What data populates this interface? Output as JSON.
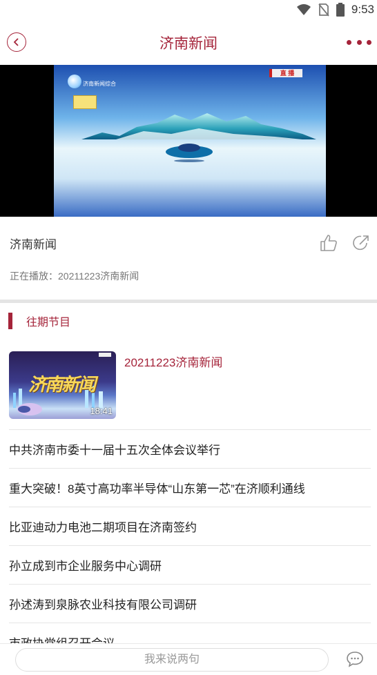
{
  "status_bar": {
    "time": "9:53",
    "icons": [
      "wifi-icon",
      "no-sim-icon",
      "battery-icon"
    ]
  },
  "header": {
    "title": "济南新闻",
    "back_icon": "chevron-left-icon",
    "more_icon": "more-dots-icon"
  },
  "colors": {
    "accent": "#a5243a",
    "divider": "#e4e4e4",
    "muted_text": "#777777"
  },
  "video": {
    "live_tag": "直 播",
    "channel_name": "济南新闻综合"
  },
  "info": {
    "title": "济南新闻",
    "playing_prefix": "正在播放：",
    "playing_title": "20211223济南新闻",
    "like_icon": "thumbs-up-icon",
    "share_icon": "share-icon"
  },
  "past_section": {
    "title": "往期节目"
  },
  "episode": {
    "title": "20211223济南新闻",
    "duration": "18:41",
    "thumb_text": "济南新闻"
  },
  "news": [
    "中共济南市委十一届十五次全体会议举行",
    "重大突破！8英寸高功率半导体“山东第一芯”在济顺利通线",
    "比亚迪动力电池二期项目在济南签约",
    "孙立成到市企业服务中心调研",
    "孙述涛到泉脉农业科技有限公司调研",
    "市政协党组召开会议"
  ],
  "bottom": {
    "placeholder": "我来说两句",
    "chat_icon": "chat-bubble-icon"
  }
}
